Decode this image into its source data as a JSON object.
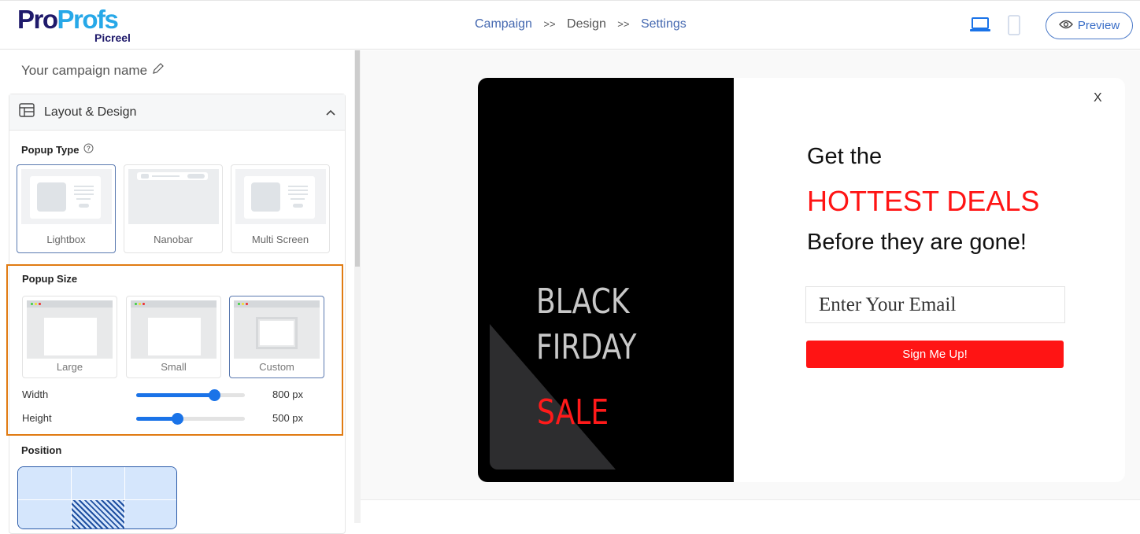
{
  "brand": {
    "logo_part1": "Pro",
    "logo_part2": "Profs",
    "sub": "Picreel"
  },
  "breadcrumb": {
    "step1": "Campaign",
    "sep": ">>",
    "step2": "Design",
    "step3": "Settings",
    "active": "Design"
  },
  "header": {
    "preview_label": "Preview",
    "devices": [
      "laptop",
      "mobile"
    ],
    "selected_device": "laptop"
  },
  "sidebar": {
    "campaign_name": "Your campaign name",
    "panel_title": "Layout & Design",
    "popup_type": {
      "label": "Popup Type",
      "options": [
        "Lightbox",
        "Nanobar",
        "Multi Screen"
      ],
      "selected": "Lightbox"
    },
    "popup_size": {
      "label": "Popup Size",
      "options": [
        "Large",
        "Small",
        "Custom"
      ],
      "selected": "Custom",
      "width": {
        "label": "Width",
        "value": "800 px",
        "fraction": 0.72
      },
      "height": {
        "label": "Height",
        "value": "500 px",
        "fraction": 0.38
      }
    },
    "position": {
      "label": "Position",
      "selected": "middle-center"
    }
  },
  "popup": {
    "left_line1": "BLACK",
    "left_line2": "FIRDAY",
    "left_line3": "SALE",
    "close": "X",
    "heading1": "Get the",
    "heading2": "HOTTEST DEALS",
    "heading3": "Before they are gone!",
    "email_placeholder": "Enter Your Email",
    "cta": "Sign Me Up!"
  },
  "colors": {
    "accent": "#1a73e8",
    "highlight": "#e07b12",
    "cta": "#ff1414",
    "brand_dark": "#1f1a6b",
    "brand_light": "#27a8e8"
  }
}
